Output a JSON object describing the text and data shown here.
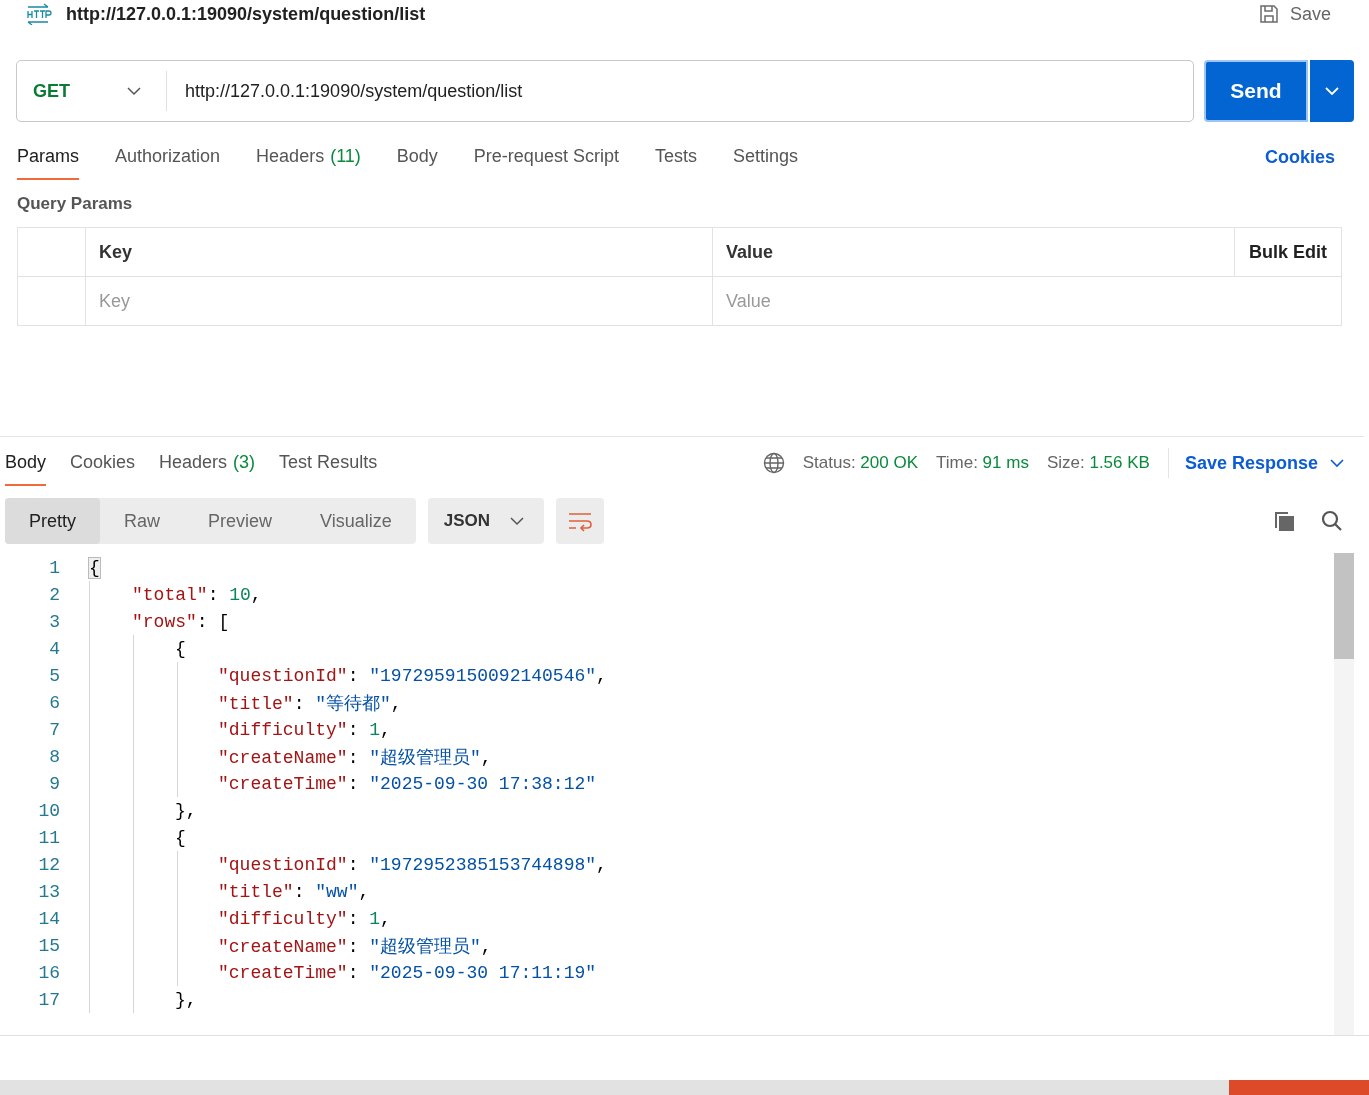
{
  "header": {
    "title": "http://127.0.0.1:19090/system/question/list",
    "save": "Save"
  },
  "request": {
    "method": "GET",
    "url": "http://127.0.0.1:19090/system/question/list",
    "send": "Send"
  },
  "request_tabs": [
    {
      "label": "Params",
      "selected": true
    },
    {
      "label": "Authorization",
      "selected": false
    },
    {
      "label": "Headers",
      "count": "(11)",
      "selected": false
    },
    {
      "label": "Body",
      "selected": false
    },
    {
      "label": "Pre-request Script",
      "selected": false
    },
    {
      "label": "Tests",
      "selected": false
    },
    {
      "label": "Settings",
      "selected": false
    }
  ],
  "cookies_link": "Cookies",
  "query_params": {
    "title": "Query Params",
    "columns": [
      "Key",
      "Value"
    ],
    "bulk_edit": "Bulk Edit",
    "placeholders": [
      "Key",
      "Value"
    ]
  },
  "response_tabs": [
    {
      "label": "Body",
      "selected": true
    },
    {
      "label": "Cookies",
      "selected": false
    },
    {
      "label": "Headers",
      "count": "(3)",
      "selected": false
    },
    {
      "label": "Test Results",
      "selected": false
    }
  ],
  "status": [
    {
      "label": "Status:",
      "value": "200 OK"
    },
    {
      "label": "Time:",
      "value": "91 ms"
    },
    {
      "label": "Size:",
      "value": "1.56 KB"
    }
  ],
  "save_response": "Save Response",
  "view_modes": [
    {
      "label": "Pretty",
      "selected": true
    },
    {
      "label": "Raw",
      "selected": false
    },
    {
      "label": "Preview",
      "selected": false
    },
    {
      "label": "Visualize",
      "selected": false
    }
  ],
  "format": "JSON",
  "code_lines": [
    {
      "number": "1",
      "tokens": [
        {
          "kind": "brace",
          "text": "{"
        }
      ],
      "children": [
        {
          "number": "2",
          "tokens": [
            {
              "kind": "key",
              "text": "\"total\""
            },
            {
              "kind": "punct",
              "text": ": "
            },
            {
              "kind": "number",
              "text": "10"
            },
            {
              "kind": "punct",
              "text": ","
            }
          ]
        },
        {
          "number": "3",
          "tokens": [
            {
              "kind": "key",
              "text": "\"rows\""
            },
            {
              "kind": "punct",
              "text": ": ["
            }
          ],
          "children": [
            {
              "number": "4",
              "tokens": [
                {
                  "kind": "punct",
                  "text": "{"
                }
              ],
              "children": [
                {
                  "number": "5",
                  "tokens": [
                    {
                      "kind": "key",
                      "text": "\"questionId\""
                    },
                    {
                      "kind": "punct",
                      "text": ": "
                    },
                    {
                      "kind": "string",
                      "text": "\"1972959150092140546\""
                    },
                    {
                      "kind": "punct",
                      "text": ","
                    }
                  ]
                },
                {
                  "number": "6",
                  "tokens": [
                    {
                      "kind": "key",
                      "text": "\"title\""
                    },
                    {
                      "kind": "punct",
                      "text": ": "
                    },
                    {
                      "kind": "string",
                      "text": "\"等待都\""
                    },
                    {
                      "kind": "punct",
                      "text": ","
                    }
                  ]
                },
                {
                  "number": "7",
                  "tokens": [
                    {
                      "kind": "key",
                      "text": "\"difficulty\""
                    },
                    {
                      "kind": "punct",
                      "text": ": "
                    },
                    {
                      "kind": "number",
                      "text": "1"
                    },
                    {
                      "kind": "punct",
                      "text": ","
                    }
                  ]
                },
                {
                  "number": "8",
                  "tokens": [
                    {
                      "kind": "key",
                      "text": "\"createName\""
                    },
                    {
                      "kind": "punct",
                      "text": ": "
                    },
                    {
                      "kind": "string",
                      "text": "\"超级管理员\""
                    },
                    {
                      "kind": "punct",
                      "text": ","
                    }
                  ]
                },
                {
                  "number": "9",
                  "tokens": [
                    {
                      "kind": "key",
                      "text": "\"createTime\""
                    },
                    {
                      "kind": "punct",
                      "text": ": "
                    },
                    {
                      "kind": "string",
                      "text": "\"2025-09-30 17:38:12\""
                    }
                  ]
                }
              ]
            },
            {
              "number": "10",
              "tokens": [
                {
                  "kind": "punct",
                  "text": "},"
                }
              ]
            },
            {
              "number": "11",
              "tokens": [
                {
                  "kind": "punct",
                  "text": "{"
                }
              ],
              "children": [
                {
                  "number": "12",
                  "tokens": [
                    {
                      "kind": "key",
                      "text": "\"questionId\""
                    },
                    {
                      "kind": "punct",
                      "text": ": "
                    },
                    {
                      "kind": "string",
                      "text": "\"1972952385153744898\""
                    },
                    {
                      "kind": "punct",
                      "text": ","
                    }
                  ]
                },
                {
                  "number": "13",
                  "tokens": [
                    {
                      "kind": "key",
                      "text": "\"title\""
                    },
                    {
                      "kind": "punct",
                      "text": ": "
                    },
                    {
                      "kind": "string",
                      "text": "\"ww\""
                    },
                    {
                      "kind": "punct",
                      "text": ","
                    }
                  ]
                },
                {
                  "number": "14",
                  "tokens": [
                    {
                      "kind": "key",
                      "text": "\"difficulty\""
                    },
                    {
                      "kind": "punct",
                      "text": ": "
                    },
                    {
                      "kind": "number",
                      "text": "1"
                    },
                    {
                      "kind": "punct",
                      "text": ","
                    }
                  ]
                },
                {
                  "number": "15",
                  "tokens": [
                    {
                      "kind": "key",
                      "text": "\"createName\""
                    },
                    {
                      "kind": "punct",
                      "text": ": "
                    },
                    {
                      "kind": "string",
                      "text": "\"超级管理员\""
                    },
                    {
                      "kind": "punct",
                      "text": ","
                    }
                  ]
                },
                {
                  "number": "16",
                  "tokens": [
                    {
                      "kind": "key",
                      "text": "\"createTime\""
                    },
                    {
                      "kind": "punct",
                      "text": ": "
                    },
                    {
                      "kind": "string",
                      "text": "\"2025-09-30 17:11:19\""
                    }
                  ]
                }
              ]
            },
            {
              "number": "17",
              "tokens": [
                {
                  "kind": "punct",
                  "text": "},"
                }
              ]
            }
          ]
        }
      ]
    }
  ]
}
